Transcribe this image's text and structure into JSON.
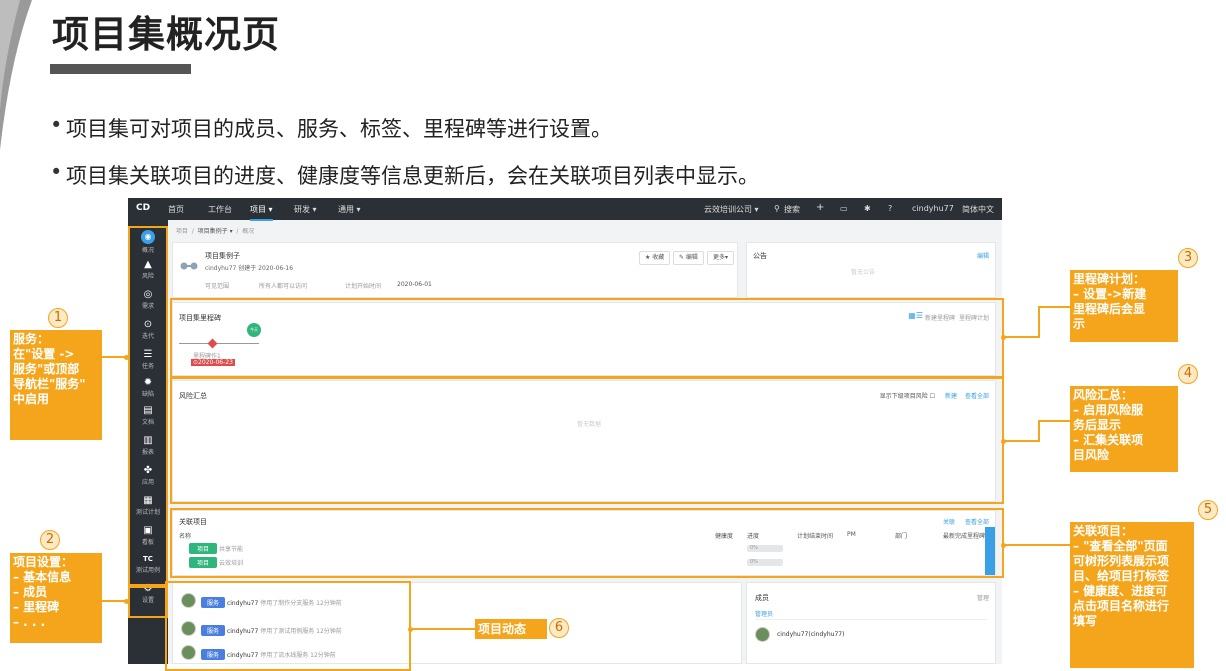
{
  "slide": {
    "title": "项目集概况页",
    "bullets": [
      "项目集可对项目的成员、服务、标签、里程碑等进行设置。",
      "项目集关联项目的进度、健康度等信息更新后，会在关联项目列表中显示。"
    ]
  },
  "topnav": {
    "logo": "CD",
    "items": [
      "首页",
      "工作台",
      "项目 ▾",
      "研发 ▾",
      "通用 ▾"
    ],
    "company": "云效培训公司 ▾",
    "search": "搜索",
    "user": "cindyhu77",
    "lang": "简体中文"
  },
  "sidenav": {
    "items": [
      "概况",
      "风险",
      "需求",
      "迭代",
      "任务",
      "缺陷",
      "文档",
      "报表",
      "应用",
      "测试计划",
      "看板",
      "测试用例",
      "设置"
    ]
  },
  "breadcrumb": {
    "root": "项目",
    "program": "项目集例子 ▾",
    "current": "概况"
  },
  "overview": {
    "name": "项目集例子",
    "creator": "cindyhu77 创建于 2020-06-16",
    "visibility_label": "可见范围",
    "visibility_value": "所有人都可以访问",
    "start_label": "计划开始时间",
    "start_value": "2020-06-01",
    "fav_button": "★ 收藏",
    "edit_button": "✎ 编辑",
    "more_button": "更多▾"
  },
  "announcement": {
    "title": "公告",
    "edit": "编辑",
    "empty": "暂无公告"
  },
  "milestone": {
    "title": "项目集里程碑",
    "new_link": "新建里程碑",
    "plan_link": "里程碑计划",
    "node_label": "里程碑作1",
    "node_date": "⊙2020-06-23",
    "today_label": "今天"
  },
  "risk": {
    "title": "风险汇总",
    "show_sub": "显示下级项目风险",
    "new": "新建",
    "view_all": "查看全部",
    "empty": "暂无数据"
  },
  "related": {
    "title": "关联项目",
    "links": [
      "关联",
      "查看全部"
    ],
    "headers": [
      "名称",
      "健康度",
      "进度",
      "计划结束时间",
      "PM",
      "部门",
      "最新完成里程碑"
    ],
    "rows": [
      {
        "tag": "项目",
        "name": "共享节能",
        "progress": "0%"
      },
      {
        "tag": "项目",
        "name": "云效培训",
        "progress": "0%"
      }
    ]
  },
  "activity": {
    "items": [
      {
        "badge": "服务",
        "user": "cindyhu77",
        "text": "停用了制作分支服务 12分钟前"
      },
      {
        "badge": "服务",
        "user": "cindyhu77",
        "text": "停用了测试用例服务 12分钟前"
      },
      {
        "badge": "服务",
        "user": "cindyhu77",
        "text": "停用了流水线服务 12分钟前"
      }
    ]
  },
  "members": {
    "title": "成员",
    "manage": "管理",
    "group": "管理员",
    "member": "cindyhu77(cindyhu77)"
  },
  "callouts": {
    "c1": {
      "num": "1",
      "head": "服务：",
      "body": "在\"设置 ->\n服务\"或顶部\n导航栏\"服务\"\n中启用"
    },
    "c2": {
      "num": "2",
      "head": "项目设置：",
      "body": "– 基本信息\n– 成员\n– 里程碑\n– . . ."
    },
    "c3": {
      "num": "3",
      "head": "里程碑计划：",
      "body": "– 设置->新建\n里程碑后会显\n示"
    },
    "c4": {
      "num": "4",
      "head": "风险汇总：",
      "body": "– 启用风险服\n务后显示\n– 汇集关联项\n目风险"
    },
    "c5": {
      "num": "5",
      "head": "关联项目：",
      "body": "– \"查看全部\"页面\n可树形列表展示项\n目、给项目打标签\n– 健康度、进度可\n点击项目名称进行\n填写"
    },
    "c6": {
      "num": "6",
      "head": "项目动态"
    }
  },
  "colors": {
    "accent": "#f5a51c",
    "nav": "#2b2f36",
    "link": "#39a0e6",
    "green": "#2fb67c"
  }
}
